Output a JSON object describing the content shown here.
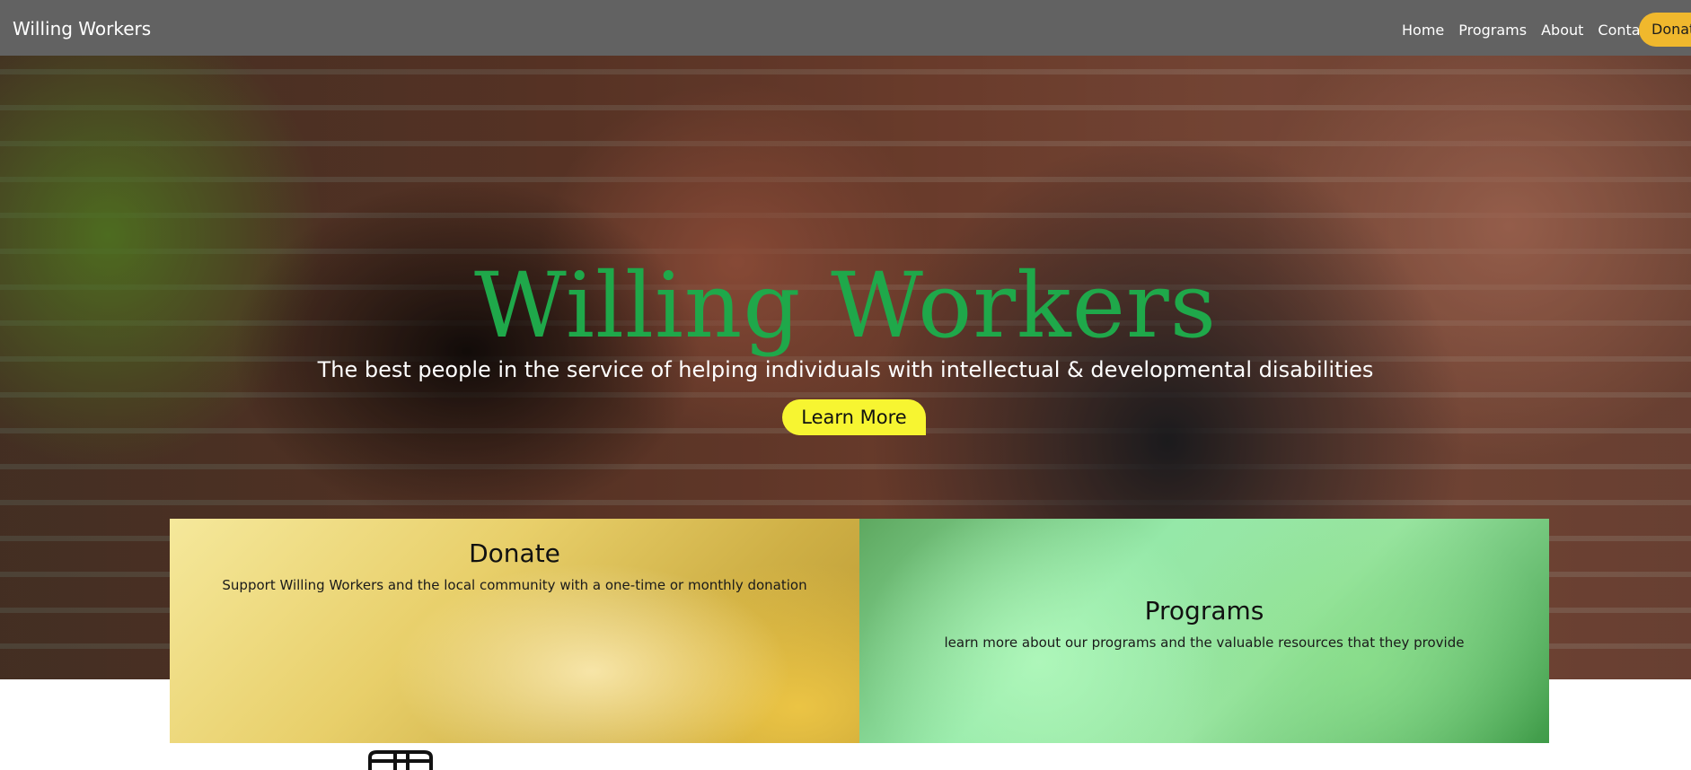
{
  "navbar": {
    "brand": "Willing Workers",
    "links": [
      "Home",
      "Programs",
      "About",
      "Contact"
    ],
    "donate_label": "Donat"
  },
  "hero": {
    "title": "Willing Workers",
    "subtitle": "The best people in the service of helping individuals with intellectual & developmental disabilities",
    "button_label": "Learn More"
  },
  "cards": [
    {
      "title": "Donate",
      "description": "Support Willing Workers and the local community with a one-time or monthly donation"
    },
    {
      "title": "Programs",
      "description": "learn more about our programs and the valuable resources that they provide"
    }
  ],
  "icons": {
    "below_fold": "program-icon"
  },
  "colors": {
    "navbar_bg": "#626262",
    "hero_title": "#1fa84a",
    "learn_button": "#f7f531",
    "donate_button": "#f0b82d",
    "donate_card": "#e8cf6a",
    "programs_card": "#95e8a8"
  }
}
